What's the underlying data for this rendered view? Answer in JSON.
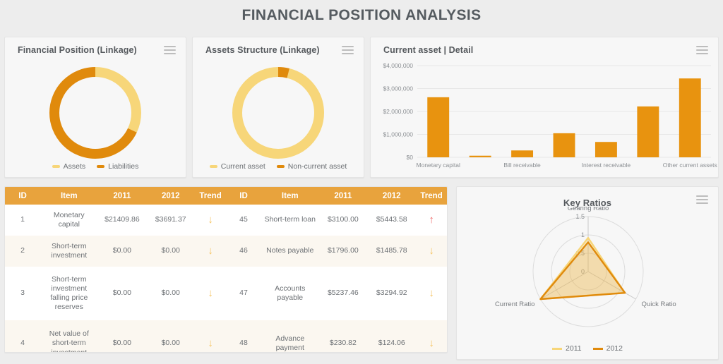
{
  "page": {
    "title": "FINANCIAL POSITION ANALYSIS",
    "bg_color": "#ededed",
    "panel_color": "#f7f7f7",
    "accent_dark": "#e08a0c",
    "accent_light": "#f7d679",
    "header_bar": "#e8a33d"
  },
  "panels": {
    "financial_position": {
      "title": "Financial Position (Linkage)",
      "menu_icon": "hamburger-icon"
    },
    "assets_structure": {
      "title": "Assets Structure (Linkage)",
      "menu_icon": "hamburger-icon"
    },
    "current_asset": {
      "title": "Current asset | Detail",
      "menu_icon": "hamburger-icon"
    },
    "key_ratios": {
      "title": "Key Ratios",
      "menu_icon": "hamburger-icon"
    }
  },
  "chart_data": [
    {
      "id": "financial-position-donut",
      "type": "pie",
      "title": "Financial Position (Linkage)",
      "legend_position": "bottom",
      "categories": [
        "Assets",
        "Liabilities"
      ],
      "values": [
        32,
        68
      ],
      "colors": [
        "#f7d679",
        "#e08a0c"
      ]
    },
    {
      "id": "assets-structure-donut",
      "type": "pie",
      "title": "Assets Structure (Linkage)",
      "legend_position": "bottom",
      "categories": [
        "Current asset",
        "Non-current asset"
      ],
      "values": [
        96,
        4
      ],
      "colors": [
        "#f7d679",
        "#e08a0c"
      ]
    },
    {
      "id": "current-asset-bars",
      "type": "bar",
      "title": "Current asset | Detail",
      "xlabel": "",
      "ylabel": "",
      "ylim": [
        0,
        4000000
      ],
      "ytick_labels": [
        "$0",
        "$1,000,000",
        "$2,000,000",
        "$3,000,000",
        "$4,000,000"
      ],
      "ytick_values": [
        0,
        1000000,
        2000000,
        3000000,
        4000000
      ],
      "grid": true,
      "categories": [
        "Monetary capital",
        "",
        "Bill receivable",
        "",
        "Interest receivable",
        "",
        "Other current assets"
      ],
      "visible_tick_labels": [
        "Monetary capital",
        "Bill receivable",
        "Interest receivable",
        "Other current assets"
      ],
      "values": [
        2620000,
        70000,
        300000,
        1050000,
        670000,
        2220000,
        3440000
      ],
      "bar_color": "#e8930f"
    },
    {
      "id": "key-ratios-radar",
      "type": "radar",
      "title": "Key Ratios",
      "legend_position": "bottom",
      "axes": [
        "Gearing Ratio",
        "Quick Ratio",
        "Current Ratio"
      ],
      "rlim": [
        0,
        1.5
      ],
      "rtick_labels": [
        "0",
        "0.5",
        "1",
        "1.5"
      ],
      "rtick_values": [
        0,
        0.5,
        1,
        1.5
      ],
      "series": [
        {
          "name": "2011",
          "values": [
            0.92,
            1.15,
            1.5
          ],
          "color": "#f7d679"
        },
        {
          "name": "2012",
          "values": [
            0.8,
            1.16,
            1.5
          ],
          "color": "#e08a0c"
        }
      ]
    }
  ],
  "table": {
    "columns": [
      "ID",
      "Item",
      "2011",
      "2012",
      "Trend",
      "ID",
      "Item",
      "2011",
      "2012",
      "Trend"
    ],
    "rows": [
      {
        "left": {
          "id": "1",
          "item": "Monetary capital",
          "y2011": "$21409.86",
          "y2012": "$3691.37",
          "trend": "down"
        },
        "right": {
          "id": "45",
          "item": "Short-term loan",
          "y2011": "$3100.00",
          "y2012": "$5443.58",
          "trend": "up"
        }
      },
      {
        "left": {
          "id": "2",
          "item": "Short-term investment",
          "y2011": "$0.00",
          "y2012": "$0.00",
          "trend": "down"
        },
        "right": {
          "id": "46",
          "item": "Notes payable",
          "y2011": "$1796.00",
          "y2012": "$1485.78",
          "trend": "down"
        }
      },
      {
        "left": {
          "id": "3",
          "item": "Short-term investment falling price reserves",
          "y2011": "$0.00",
          "y2012": "$0.00",
          "trend": "down"
        },
        "right": {
          "id": "47",
          "item": "Accounts payable",
          "y2011": "$5237.46",
          "y2012": "$3294.92",
          "trend": "down"
        }
      },
      {
        "left": {
          "id": "4",
          "item": "Net value of short-term investment",
          "y2011": "$0.00",
          "y2012": "$0.00",
          "trend": "down"
        },
        "right": {
          "id": "48",
          "item": "Advance payment",
          "y2011": "$230.82",
          "y2012": "$124.06",
          "trend": "down"
        }
      }
    ],
    "trend_glyphs": {
      "up": "↑",
      "down": "↓"
    }
  }
}
